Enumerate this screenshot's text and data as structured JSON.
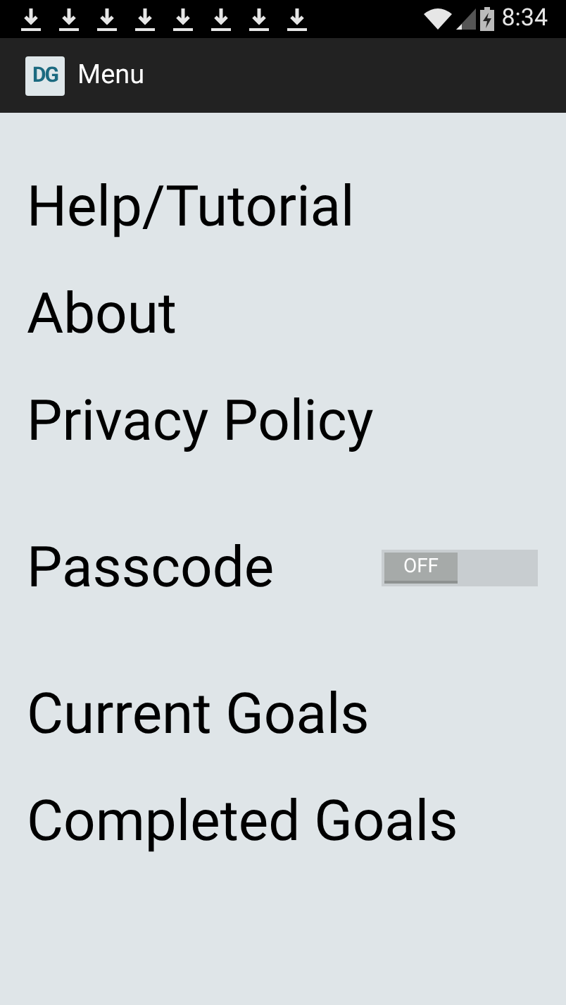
{
  "status_bar": {
    "notifications": [
      {
        "kind": "download"
      },
      {
        "kind": "download"
      },
      {
        "kind": "download"
      },
      {
        "kind": "download"
      },
      {
        "kind": "download"
      },
      {
        "kind": "download"
      },
      {
        "kind": "download"
      },
      {
        "kind": "download"
      }
    ],
    "time": "8:34"
  },
  "app_bar": {
    "logo_text": "DG",
    "title": "Menu"
  },
  "menu": [
    {
      "kind": "link",
      "label": "Help/Tutorial"
    },
    {
      "kind": "link",
      "label": "About"
    },
    {
      "kind": "link",
      "label": "Privacy Policy"
    },
    {
      "kind": "toggle",
      "label": "Passcode",
      "on": false,
      "state_label": "OFF"
    },
    {
      "kind": "link",
      "label": "Current Goals"
    },
    {
      "kind": "link",
      "label": "Completed Goals"
    }
  ]
}
